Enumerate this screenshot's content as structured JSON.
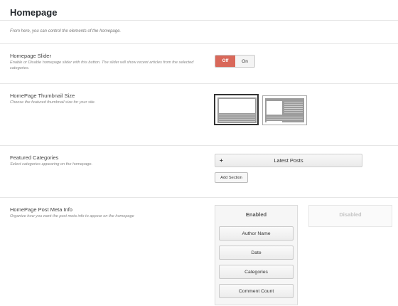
{
  "header": {
    "title": "Homepage"
  },
  "intro": {
    "text": "From here, you can control the elements of the homepage."
  },
  "slider": {
    "title": "Homepage Slider",
    "description": "Enable or Disable homepage slider with this button. The slider will show recent articles from the selected categories.",
    "off_label": "Off",
    "on_label": "On",
    "state": "Off"
  },
  "thumbnail": {
    "title": "HomePage Thumbnail Size",
    "description": "Choose the featured thumbnail size for your site."
  },
  "featured": {
    "title": "Featured Categories",
    "description": "Select categories appearing on the homepage.",
    "plus_label": "+",
    "category_label": "Latest Posts",
    "add_section_label": "Add Section"
  },
  "meta": {
    "title": "HomePage Post Meta Info",
    "description": "Organize how you want the post meta info to appear on the homepage",
    "enabled_heading": "Enabled",
    "disabled_heading": "Disabled",
    "enabled_items": [
      "Author Name",
      "Date",
      "Categories",
      "Comment Count"
    ]
  },
  "colors": {
    "accent_off": "#d9685a"
  }
}
